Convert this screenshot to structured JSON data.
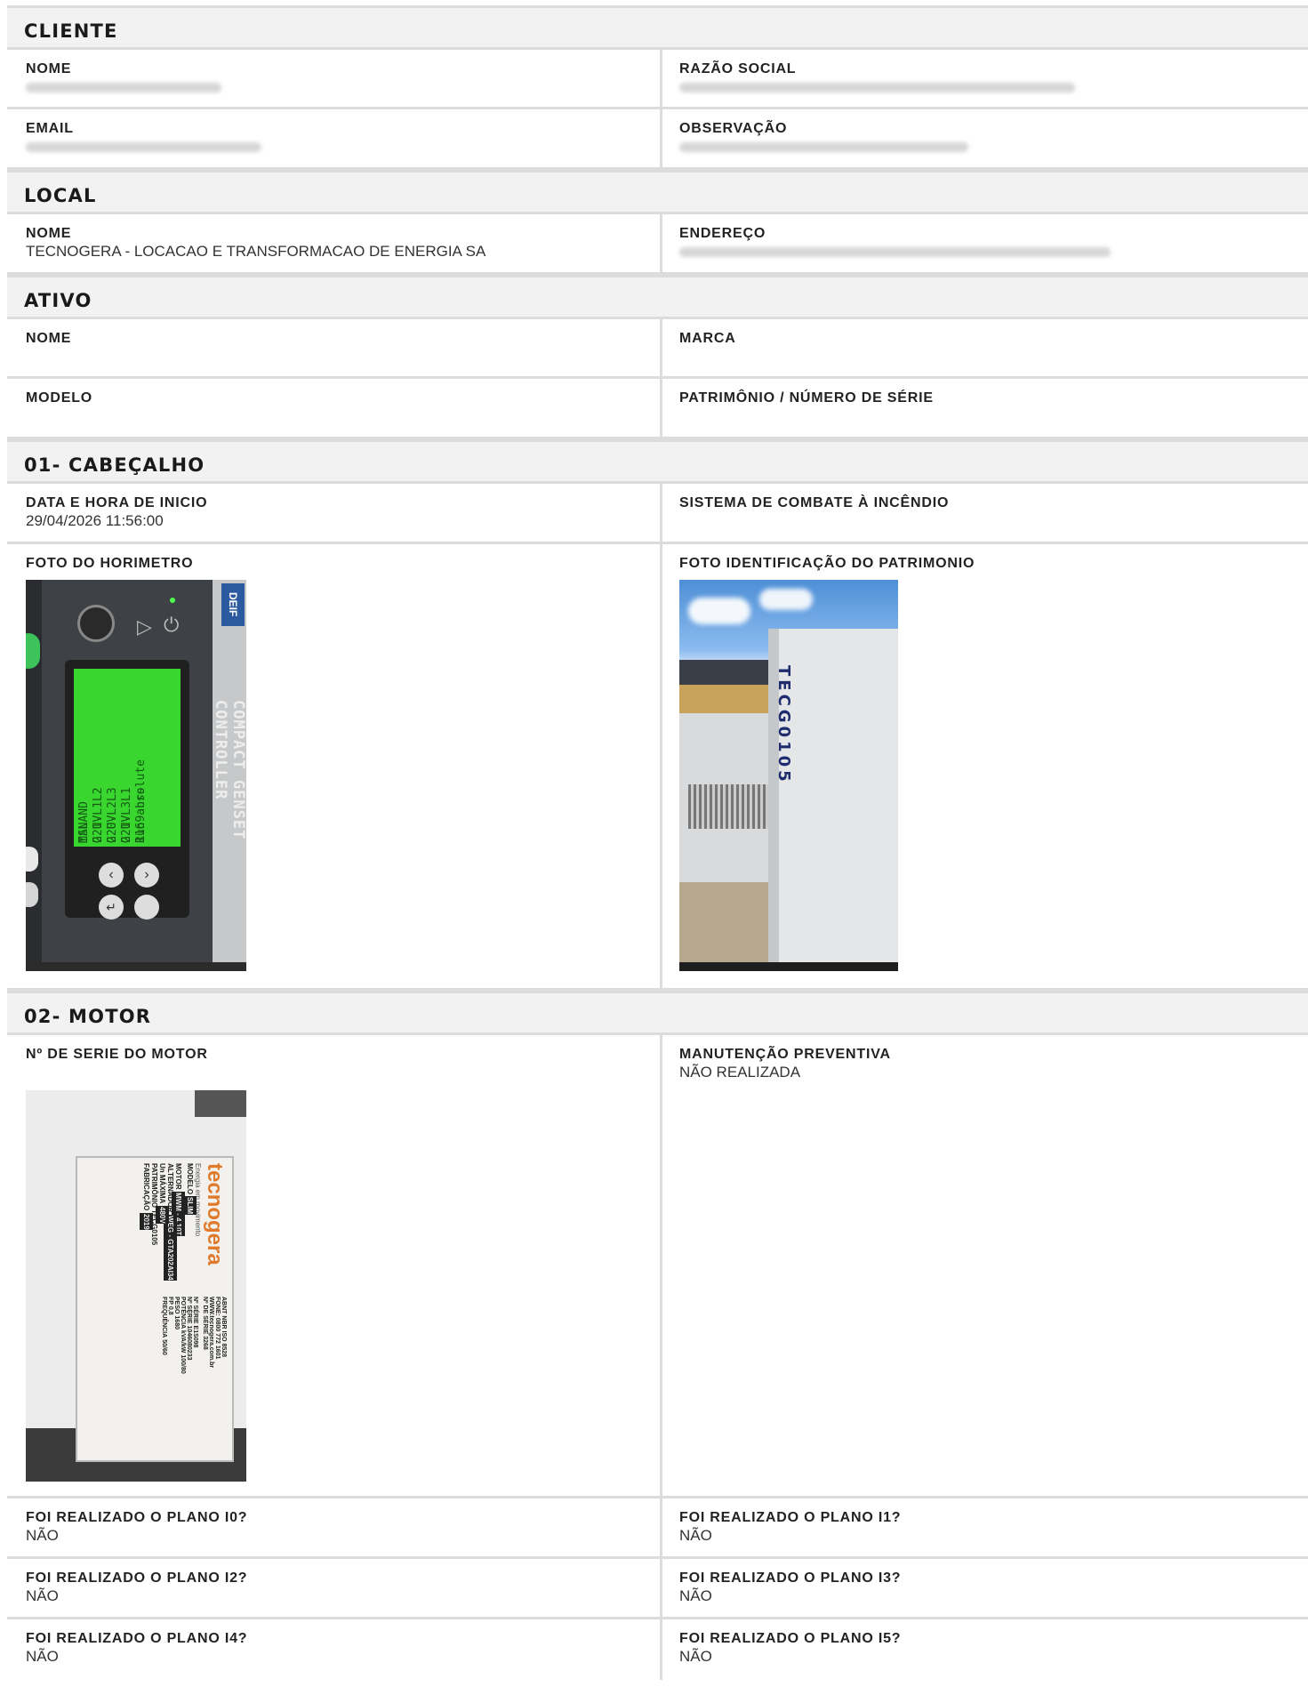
{
  "cliente": {
    "title": "CLIENTE",
    "nome_label": "NOME",
    "razao_label": "RAZÃO SOCIAL",
    "email_label": "EMAIL",
    "obs_label": "OBSERVAÇÃO"
  },
  "local": {
    "title": "LOCAL",
    "nome_label": "NOME",
    "nome_value": "TECNOGERA - LOCACAO E TRANSFORMACAO DE ENERGIA SA",
    "endereco_label": "ENDEREÇO"
  },
  "ativo": {
    "title": "ATIVO",
    "nome_label": "NOME",
    "marca_label": "MARCA",
    "modelo_label": "MODELO",
    "patrimonio_label": "PATRIMÔNIO / NÚMERO DE SÉRIE"
  },
  "cabecalho": {
    "title": "01- CABEÇALHO",
    "data_label": "DATA E HORA DE INICIO",
    "data_value": "29/04/2026 11:56:00",
    "sistema_label": "SISTEMA DE COMBATE À INCÊNDIO",
    "foto_horimetro_label": "FOTO DO HORIMETRO",
    "foto_patrimonio_label": "FOTO IDENTIFICAÇÃO DO PATRIMONIO",
    "screen_lines": [
      "ISLAND",
      "MAN",
      "G  U-L1L2",
      "221V",
      "G  U-L2L3",
      "220V",
      "G  U-L3L1",
      "221V",
      "Run absolute",
      "1169 hrs"
    ],
    "panel_text": "COMPACT GENSET CONTROLLER",
    "brand_badge": "DEIF",
    "unit_marking": "TECG0105"
  },
  "motor": {
    "title": "02- MOTOR",
    "serie_label": "Nº DE SERIE DO MOTOR",
    "manut_label": "MANUTENÇÃO PREVENTIVA",
    "manut_value": "NÃO REALIZADA",
    "plate": {
      "brand": "tecnogera",
      "tagline": "Energia em movimento",
      "standard": "ABNT NBR ISO 8528",
      "phone": "FONE: 0800 772 1601",
      "site": "WWW.tecnogera.com.br",
      "fields": [
        {
          "label": "MODELO",
          "value": "SLIM"
        },
        {
          "label": "Nº DE SÉRIE",
          "value": "3268"
        },
        {
          "label": "MOTOR",
          "value": "MWM - 4.10T"
        },
        {
          "label": "Nº SÉRIE",
          "value": "E1S098"
        },
        {
          "label": "ALTERNADOR",
          "value": "WEG - GTA202AI34"
        },
        {
          "label": "Nº SÉRIE",
          "value": "1046080233"
        },
        {
          "label": "Un MÁXIMA",
          "value": "480V"
        },
        {
          "label": "POTÊNCIA kVA/kW",
          "value": "100/80"
        },
        {
          "label": "PATRIMÔNIO",
          "value": "TECG0105"
        },
        {
          "label": "FABRICAÇÃO",
          "value": "2019"
        },
        {
          "label": "PESO",
          "value": "1680"
        },
        {
          "label": "FP",
          "value": "0,8"
        },
        {
          "label": "FREQUÊNCIA",
          "value": "50/60"
        }
      ]
    },
    "planos": [
      {
        "label": "FOI REALIZADO O PLANO I0?",
        "value": "NÃO"
      },
      {
        "label": "FOI REALIZADO O PLANO I1?",
        "value": "NÃO"
      },
      {
        "label": "FOI REALIZADO O PLANO I2?",
        "value": "NÃO"
      },
      {
        "label": "FOI REALIZADO O PLANO I3?",
        "value": "NÃO"
      },
      {
        "label": "FOI REALIZADO O PLANO I4?",
        "value": "NÃO"
      },
      {
        "label": "FOI REALIZADO O PLANO I5?",
        "value": "NÃO"
      }
    ]
  },
  "colors": {
    "section_bg": "#f2f2f2",
    "border": "#dcdcdc",
    "lcd_green": "#39d630"
  }
}
